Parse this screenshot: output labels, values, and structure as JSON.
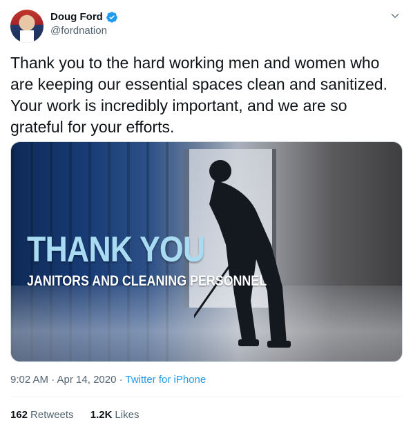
{
  "author": {
    "display_name": "Doug Ford",
    "handle": "@fordnation",
    "verified": true,
    "avatar_icon": "profile-photo"
  },
  "tweet": {
    "text": "Thank you to the hard working men and women who are keeping our essential spaces clean and sanitized. Your work is incredibly important, and we are so grateful for your efforts."
  },
  "media": {
    "headline": "THANK YOU",
    "subline": "JANITORS AND CLEANING PERSONNEL"
  },
  "meta": {
    "time": "9:02 AM · Apr 14, 2020",
    "separator": " · ",
    "source": "Twitter for iPhone"
  },
  "stats": {
    "retweets_count": "162",
    "retweets_label": "Retweets",
    "likes_count": "1.2K",
    "likes_label": "Likes"
  },
  "colors": {
    "accent": "#1d9bf0",
    "text_primary": "#0f1419",
    "text_secondary": "#536471",
    "headline": "#a9dcf2"
  }
}
